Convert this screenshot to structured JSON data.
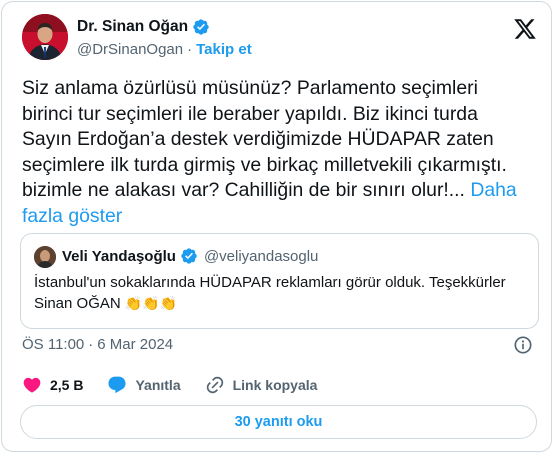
{
  "author": {
    "name": "Dr. Sinan Oğan",
    "handle": "@DrSinanOgan",
    "separator": "·",
    "follow_label": "Takip et"
  },
  "tweet": {
    "text": "Siz anlama özürlüsü müsünüz? Parlamento seçimleri\nbirinci tur seçimleri ile beraber yapıldı. Biz ikinci turda\nSayın Erdoğan’a destek verdiğimizde HÜDAPAR zaten\nseçimlere ilk turda girmiş ve birkaç milletvekili çıkarmıştı.\nbizimle ne alakası var? Cahilliğin de bir sınırı olur!... ",
    "more_label": "Daha\nfazla göster"
  },
  "quote": {
    "name": "Veli Yandaşoğlu",
    "handle": "@veliyandasoglu",
    "text": "İstanbul'un sokaklarında HÜDAPAR reklamları görür olduk. Teşekkürler\nSinan OĞAN ",
    "emoji": "👏👏👏"
  },
  "meta": {
    "time": "ÖS 11:00",
    "separator": "·",
    "date": "6 Mar 2024"
  },
  "actions": {
    "likes": "2,5 B",
    "reply_label": "Yanıtla",
    "copy_link_label": "Link kopyala"
  },
  "replies_button": "30 yanıtı oku",
  "colors": {
    "accent": "#1d9bf0",
    "like": "#f91880",
    "text": "#0f1419",
    "muted": "#536471",
    "border": "#cfd9de"
  },
  "icons": [
    "verified-badge-icon",
    "x-logo-icon",
    "info-icon",
    "heart-icon",
    "reply-bubble-icon",
    "link-icon"
  ]
}
